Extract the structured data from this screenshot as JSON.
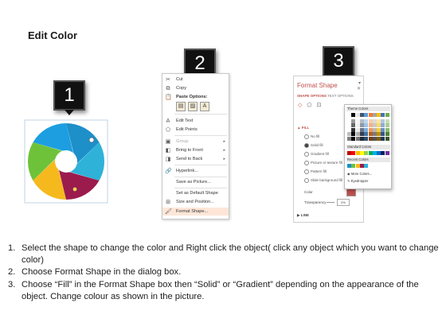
{
  "heading": "Edit Color",
  "badges": [
    "1",
    "2",
    "3"
  ],
  "wheel": {
    "segments": [
      "#1d8fc9",
      "#2fb2d8",
      "#9b1b4d",
      "#f5b91e",
      "#6ec23a",
      "#1d9ee0"
    ]
  },
  "context_menu": {
    "items": [
      {
        "icon": "cut-icon",
        "label": "Cut",
        "glyph": "✂"
      },
      {
        "icon": "copy-icon",
        "label": "Copy",
        "glyph": "⧉"
      },
      {
        "icon": "paste-icon",
        "label": "Paste Options:",
        "glyph": "📋"
      },
      {
        "icon": "edit-text-icon",
        "label": "Edit Text",
        "glyph": "A"
      },
      {
        "icon": "edit-points-icon",
        "label": "Edit Points",
        "glyph": "⬠"
      },
      {
        "icon": "group-icon",
        "label": "Group",
        "glyph": "▣"
      },
      {
        "icon": "bring-front-icon",
        "label": "Bring to Front",
        "glyph": "◧"
      },
      {
        "icon": "send-back-icon",
        "label": "Send to Back",
        "glyph": "◨"
      },
      {
        "icon": "hyperlink-icon",
        "label": "Hyperlink...",
        "glyph": "🔗"
      },
      {
        "icon": "",
        "label": "Save as Picture...",
        "glyph": ""
      },
      {
        "icon": "",
        "label": "Set as Default Shape",
        "glyph": ""
      },
      {
        "icon": "size-position-icon",
        "label": "Size and Position...",
        "glyph": "⊞"
      },
      {
        "icon": "format-shape-icon",
        "label": "Format Shape...",
        "glyph": "🖌"
      }
    ]
  },
  "format_pane": {
    "title": "Format Shape",
    "tabs": [
      "SHAPE OPTIONS",
      "TEXT OPTIONS"
    ],
    "section_fill": "FILL",
    "fill_options": [
      "No fill",
      "Solid fill",
      "Gradient fill",
      "Picture or texture fill",
      "Pattern fill",
      "Slide background fill"
    ],
    "color_label": "Color",
    "transparency_label": "Transparency",
    "transparency_value": "0%",
    "section_line": "LINE"
  },
  "color_popup": {
    "theme_colors": "Theme Colors",
    "standard_colors": "Standard Colors",
    "recent_colors": "Recent Colors",
    "more_colors": "More Colors...",
    "eyedropper": "Eyedropper",
    "theme_top": [
      "#ffffff",
      "#000000",
      "#e7e6e6",
      "#44546a",
      "#5b9bd5",
      "#ed7d31",
      "#a5a5a5",
      "#ffc000",
      "#4472c4",
      "#70ad47"
    ],
    "standard": [
      "#c00000",
      "#ff0000",
      "#ffc000",
      "#ffff00",
      "#92d050",
      "#00b050",
      "#00b0f0",
      "#0070c0",
      "#002060",
      "#7030a0"
    ],
    "recent": [
      "#1d8fc9",
      "#6ec23a",
      "#f5b91e",
      "#9b1b4d",
      "#2fb2d8"
    ]
  },
  "instructions": [
    {
      "num": "1.",
      "text": "Select the shape to change the color and Right click the object( click any object which you want to change color)"
    },
    {
      "num": "2.",
      "text": "Choose Format Shape in the dialog box."
    },
    {
      "num": "3.",
      "text": "Choose “Fill” in the Format Shape box then “Solid” or “Gradient” depending on the appearance of the object. Change colour as shown in the picture."
    }
  ]
}
